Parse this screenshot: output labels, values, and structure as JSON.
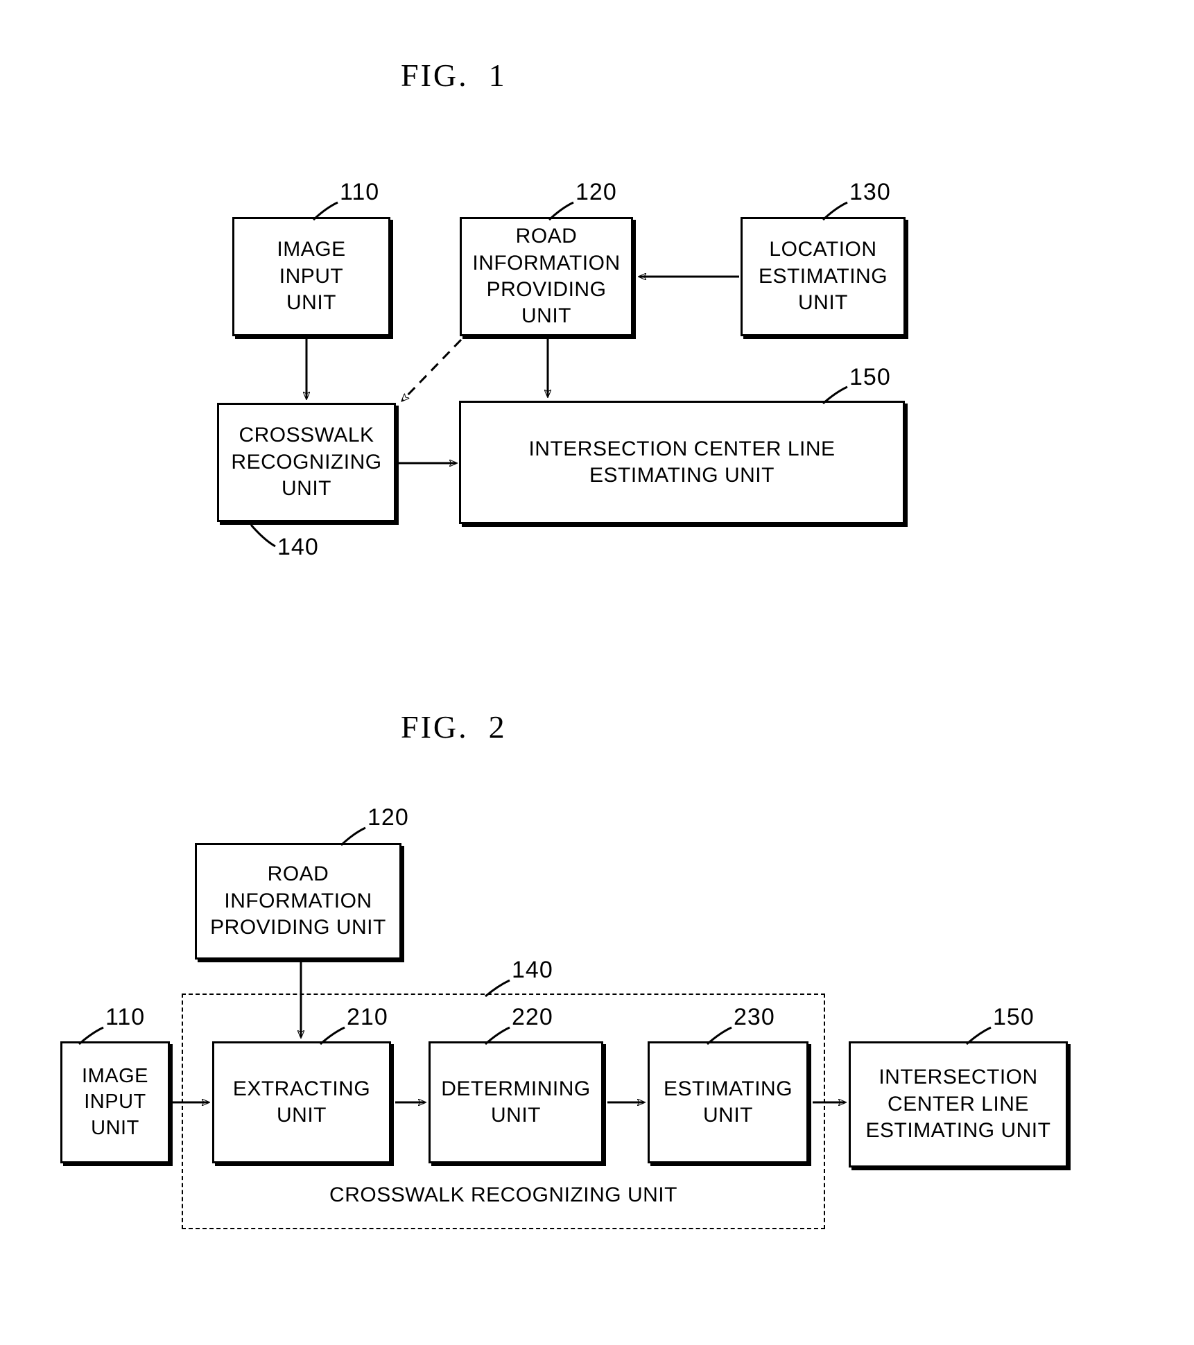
{
  "figures": [
    {
      "id": "fig1",
      "title": "FIG.  1",
      "boxes": {
        "image_input_unit": "IMAGE\nINPUT\nUNIT",
        "road_information_providing_unit": "ROAD\nINFORMATION\nPROVIDING UNIT",
        "location_estimating_unit": "LOCATION\nESTIMATING\nUNIT",
        "crosswalk_recognizing_unit": "CROSSWALK\nRECOGNIZING\nUNIT",
        "intersection_center_line_estimating_unit": "INTERSECTION CENTER LINE\nESTIMATING UNIT"
      },
      "refs": {
        "image_input_unit": "110",
        "road_information_providing_unit": "120",
        "location_estimating_unit": "130",
        "crosswalk_recognizing_unit": "140",
        "intersection_center_line_estimating_unit": "150"
      }
    },
    {
      "id": "fig2",
      "title": "FIG.  2",
      "boxes": {
        "road_information_providing_unit": "ROAD\nINFORMATION\nPROVIDING UNIT",
        "image_input_unit": "IMAGE\nINPUT\nUNIT",
        "extracting_unit": "EXTRACTING\nUNIT",
        "determining_unit": "DETERMINING\nUNIT",
        "estimating_unit": "ESTIMATING\nUNIT",
        "intersection_center_line_estimating_unit": "INTERSECTION\nCENTER LINE\nESTIMATING UNIT"
      },
      "group_caption": "CROSSWALK RECOGNIZING UNIT",
      "refs": {
        "road_information_providing_unit": "120",
        "image_input_unit": "110",
        "extracting_unit": "210",
        "determining_unit": "220",
        "estimating_unit": "230",
        "crosswalk_recognizing_unit_group": "140",
        "intersection_center_line_estimating_unit": "150"
      }
    }
  ],
  "colors": {
    "ink": "#000000",
    "paper": "#ffffff"
  }
}
